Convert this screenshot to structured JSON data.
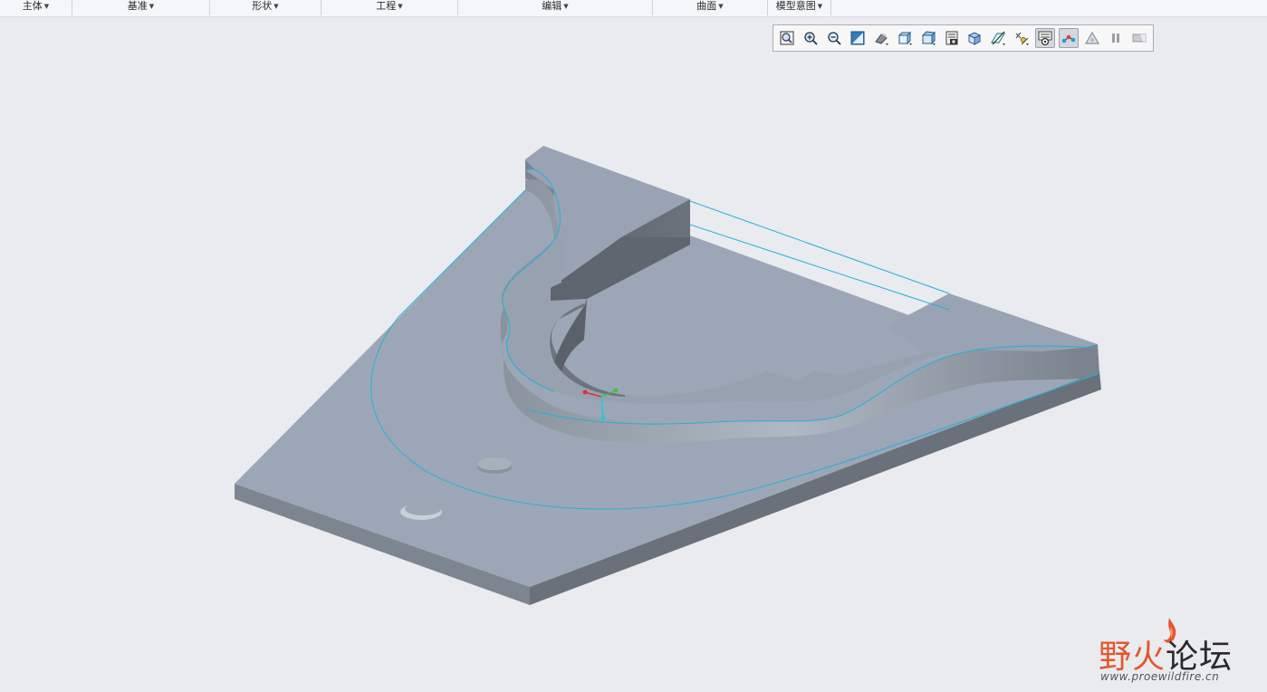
{
  "ribbon": {
    "groups": [
      {
        "label": "主体"
      },
      {
        "label": "基准"
      },
      {
        "label": "形状"
      },
      {
        "label": "工程"
      },
      {
        "label": "编辑"
      },
      {
        "label": "曲面"
      },
      {
        "label": "模型意图"
      }
    ]
  },
  "view_toolbar": {
    "buttons": [
      {
        "icon": "refit-icon",
        "active": false
      },
      {
        "icon": "zoom-in-icon",
        "active": false
      },
      {
        "icon": "zoom-out-icon",
        "active": false
      },
      {
        "icon": "repaint-icon",
        "active": false
      },
      {
        "icon": "display-style-icon",
        "active": false
      },
      {
        "icon": "saved-orientations-icon",
        "active": false
      },
      {
        "icon": "view-manager-icon",
        "active": false
      },
      {
        "icon": "perspective-view-icon",
        "active": false
      },
      {
        "icon": "section-icon",
        "active": false
      },
      {
        "icon": "datum-display-filter-icon",
        "active": false
      },
      {
        "icon": "annotation-display-icon",
        "active": false
      },
      {
        "icon": "spin-center-icon",
        "active": true
      },
      {
        "icon": "datum-points-display-icon",
        "active": true
      },
      {
        "icon": "simulation-display-icon",
        "active": false
      },
      {
        "icon": "pause-icon",
        "active": false
      },
      {
        "icon": "animation-icon",
        "active": false
      }
    ]
  },
  "watermark": {
    "title_red": "野火",
    "title_dark": "论坛",
    "url": "www.proewildfire.cn"
  },
  "colors": {
    "background": "#e9ebef",
    "part_top": "#9ca6b6",
    "part_side": "#6c737d",
    "highlight_edge": "#1fb3d6",
    "watermark_red": "#e4572e"
  }
}
